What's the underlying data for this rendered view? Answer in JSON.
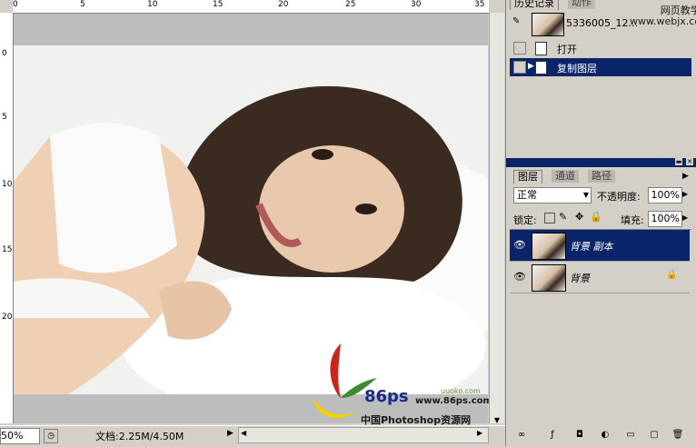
{
  "rulers": {
    "top_ticks": [
      "0",
      "5",
      "10",
      "15",
      "20",
      "25",
      "30",
      "35"
    ],
    "left_ticks": [
      "0",
      "5",
      "10",
      "15",
      "20"
    ]
  },
  "status": {
    "zoom": "50%",
    "doc_size": "文档:2.25M/4.50M"
  },
  "watermark": {
    "brand": "86ps",
    "url": "www.86ps.com",
    "site": "中国Photoshop资源网",
    "small": "uuoko.com"
  },
  "top_watermark": "网页教学网\nwww.webjx.com",
  "history_panel": {
    "tabs": [
      {
        "label": "历史记录",
        "active": true
      },
      {
        "label": "动作",
        "active": false
      }
    ],
    "snapshot_name": "5336005_12...",
    "items": [
      {
        "label": "打开",
        "selected": false
      },
      {
        "label": "复制图层",
        "selected": true
      }
    ]
  },
  "layers_panel": {
    "tabs": [
      {
        "label": "图层",
        "active": true
      },
      {
        "label": "通道",
        "active": false
      },
      {
        "label": "路径",
        "active": false
      }
    ],
    "blend_mode": "正常",
    "opacity_label": "不透明度:",
    "opacity_value": "100%",
    "lock_label": "锁定:",
    "fill_label": "填充:",
    "fill_value": "100%",
    "layers": [
      {
        "name": "背景 副本",
        "selected": true,
        "locked": false
      },
      {
        "name": "背景",
        "selected": false,
        "locked": true
      }
    ]
  }
}
